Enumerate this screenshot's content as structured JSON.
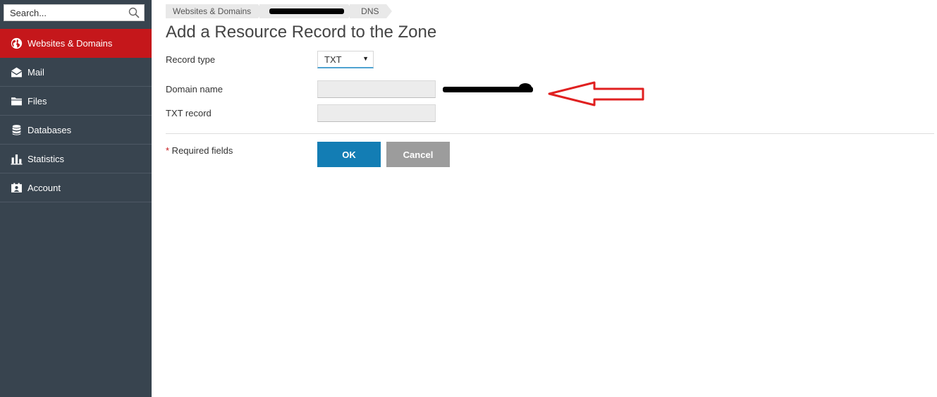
{
  "sidebar": {
    "search": {
      "placeholder": "Search..."
    },
    "items": [
      {
        "label": "Websites & Domains",
        "icon": "globe-icon",
        "active": true
      },
      {
        "label": "Mail",
        "icon": "mail-icon",
        "active": false
      },
      {
        "label": "Files",
        "icon": "folder-icon",
        "active": false
      },
      {
        "label": "Databases",
        "icon": "database-icon",
        "active": false
      },
      {
        "label": "Statistics",
        "icon": "bar-chart-icon",
        "active": false
      },
      {
        "label": "Account",
        "icon": "account-icon",
        "active": false
      }
    ]
  },
  "breadcrumb": {
    "items": [
      "Websites & Domains",
      "",
      "DNS"
    ]
  },
  "page": {
    "title": "Add a Resource Record to the Zone"
  },
  "form": {
    "record_type": {
      "label": "Record type",
      "value": "TXT"
    },
    "domain_name": {
      "label": "Domain name",
      "value": ""
    },
    "txt_record": {
      "label": "TXT record",
      "value": ""
    },
    "required_note": {
      "star": "*",
      "text": " Required fields"
    },
    "ok_label": "OK",
    "cancel_label": "Cancel"
  },
  "colors": {
    "sidebar_bg": "#38444f",
    "active_item": "#c5171b",
    "ok_button": "#137db4",
    "cancel_button": "#9c9c9c",
    "annotation_arrow": "#e02020"
  }
}
